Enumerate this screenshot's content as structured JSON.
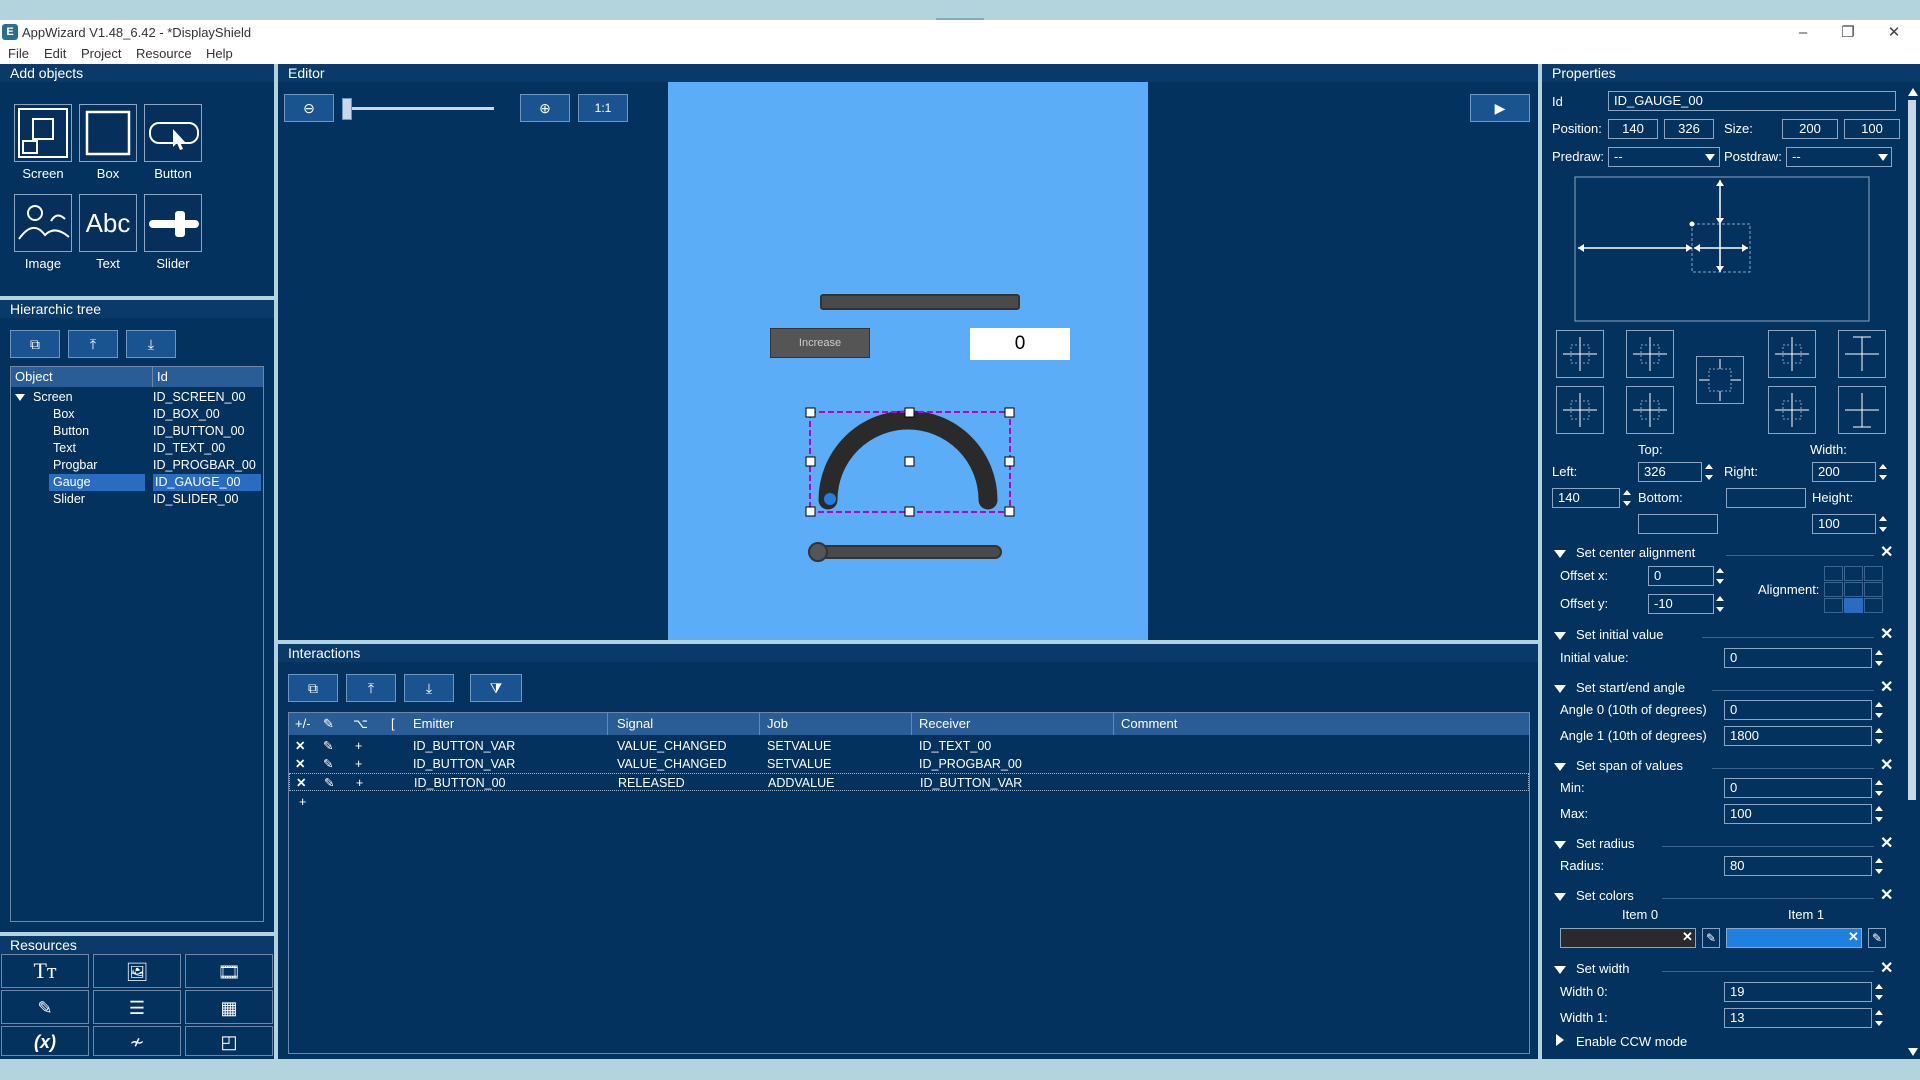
{
  "window": {
    "title": "AppWizard V1.48_6.42 - *DisplayShield",
    "logo": "E",
    "controls": [
      "–",
      "❐",
      "✕"
    ]
  },
  "menu": [
    "File",
    "Edit",
    "Project",
    "Resource",
    "Help"
  ],
  "add_objects": {
    "title": "Add objects",
    "items": [
      {
        "label": "Screen",
        "icon": "screen-icon"
      },
      {
        "label": "Box",
        "icon": "box-icon"
      },
      {
        "label": "Button",
        "icon": "button-icon"
      },
      {
        "label": "Image",
        "icon": "image-icon"
      },
      {
        "label": "Text",
        "icon": "text-icon",
        "glyph": "Abc"
      },
      {
        "label": "Slider",
        "icon": "slider-icon"
      }
    ]
  },
  "hierarchic_tree": {
    "title": "Hierarchic tree",
    "columns": [
      "Object",
      "Id"
    ],
    "rows": [
      {
        "object": "Screen",
        "id": "ID_SCREEN_00",
        "selected": false
      },
      {
        "object": "Box",
        "id": "ID_BOX_00",
        "selected": false
      },
      {
        "object": "Button",
        "id": "ID_BUTTON_00",
        "selected": false
      },
      {
        "object": "Text",
        "id": "ID_TEXT_00",
        "selected": false
      },
      {
        "object": "Progbar",
        "id": "ID_PROGBAR_00",
        "selected": false
      },
      {
        "object": "Gauge",
        "id": "ID_GAUGE_00",
        "selected": true
      },
      {
        "object": "Slider",
        "id": "ID_SLIDER_00",
        "selected": false
      }
    ]
  },
  "resources": {
    "title": "Resources"
  },
  "editor": {
    "title": "Editor",
    "zoom_label": "1:1",
    "canvas": {
      "button_label": "Increase",
      "text_value": "0"
    }
  },
  "interactions": {
    "title": "Interactions",
    "columns": [
      "+/-",
      "",
      "",
      "[",
      "Emitter",
      "Signal",
      "Job",
      "Receiver",
      "Comment"
    ],
    "rows": [
      {
        "emitter": "ID_BUTTON_VAR",
        "signal": "VALUE_CHANGED",
        "job": "SETVALUE",
        "receiver": "ID_TEXT_00",
        "comment": ""
      },
      {
        "emitter": "ID_BUTTON_VAR",
        "signal": "VALUE_CHANGED",
        "job": "SETVALUE",
        "receiver": "ID_PROGBAR_00",
        "comment": ""
      },
      {
        "emitter": "ID_BUTTON_00",
        "signal": "RELEASED",
        "job": "ADDVALUE",
        "receiver": "ID_BUTTON_VAR",
        "comment": ""
      }
    ],
    "add_row": "+"
  },
  "properties": {
    "title": "Properties",
    "id_label": "Id",
    "id_value": "ID_GAUGE_00",
    "position_label": "Position:",
    "pos_x": "140",
    "pos_y": "326",
    "size_label": "Size:",
    "size_w": "200",
    "size_h": "100",
    "predraw_label": "Predraw:",
    "predraw_value": "--",
    "postdraw_label": "Postdraw:",
    "postdraw_value": "--",
    "top_label": "Top:",
    "width_label": "Width:",
    "left_label": "Left:",
    "right_label": "Right:",
    "top_value": "326",
    "right_value": "200",
    "left_value": "140",
    "bottom_label": "Bottom:",
    "height_label": "Height:",
    "height_value": "100",
    "sections": {
      "center": {
        "title": "Set center alignment",
        "offx_label": "Offset x:",
        "offx": "0",
        "offy_label": "Offset y:",
        "offy": "-10",
        "align_label": "Alignment:"
      },
      "initial": {
        "title": "Set initial value",
        "label": "Initial value:",
        "value": "0"
      },
      "angle": {
        "title": "Set start/end angle",
        "a0_label": "Angle 0 (10th of degrees)",
        "a0": "0",
        "a1_label": "Angle 1 (10th of degrees)",
        "a1": "1800"
      },
      "span": {
        "title": "Set span of values",
        "min_label": "Min:",
        "min": "0",
        "max_label": "Max:",
        "max": "100"
      },
      "radius": {
        "title": "Set radius",
        "label": "Radius:",
        "value": "80"
      },
      "colors": {
        "title": "Set colors",
        "item0": "Item 0",
        "item1": "Item 1",
        "color0": "#2a2a2a",
        "color1": "#1f80e0"
      },
      "width": {
        "title": "Set width",
        "w0_label": "Width 0:",
        "w0": "19",
        "w1_label": "Width 1:",
        "w1": "13"
      },
      "ccw": {
        "title": "Enable CCW mode"
      }
    }
  }
}
